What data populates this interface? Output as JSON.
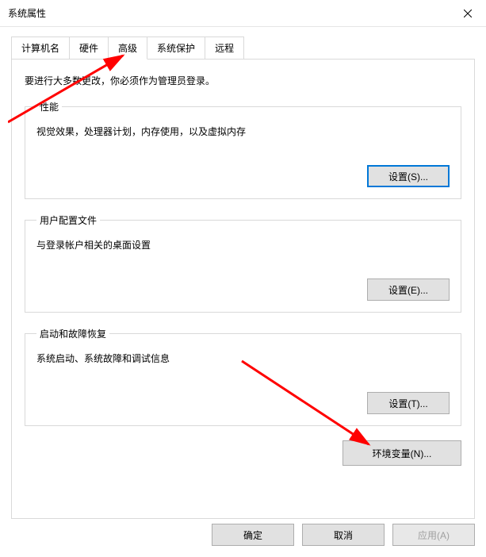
{
  "window": {
    "title": "系统属性"
  },
  "tabs": [
    {
      "label": "计算机名"
    },
    {
      "label": "硬件"
    },
    {
      "label": "高级",
      "active": true
    },
    {
      "label": "系统保护"
    },
    {
      "label": "远程"
    }
  ],
  "advanced": {
    "admin_note": "要进行大多数更改，你必须作为管理员登录。",
    "performance": {
      "legend": "性能",
      "desc": "视觉效果，处理器计划，内存使用，以及虚拟内存",
      "button": "设置(S)..."
    },
    "user_profiles": {
      "legend": "用户配置文件",
      "desc": "与登录帐户相关的桌面设置",
      "button": "设置(E)..."
    },
    "startup": {
      "legend": "启动和故障恢复",
      "desc": "系统启动、系统故障和调试信息",
      "button": "设置(T)..."
    },
    "env_button": "环境变量(N)..."
  },
  "footer": {
    "ok": "确定",
    "cancel": "取消",
    "apply": "应用(A)"
  }
}
